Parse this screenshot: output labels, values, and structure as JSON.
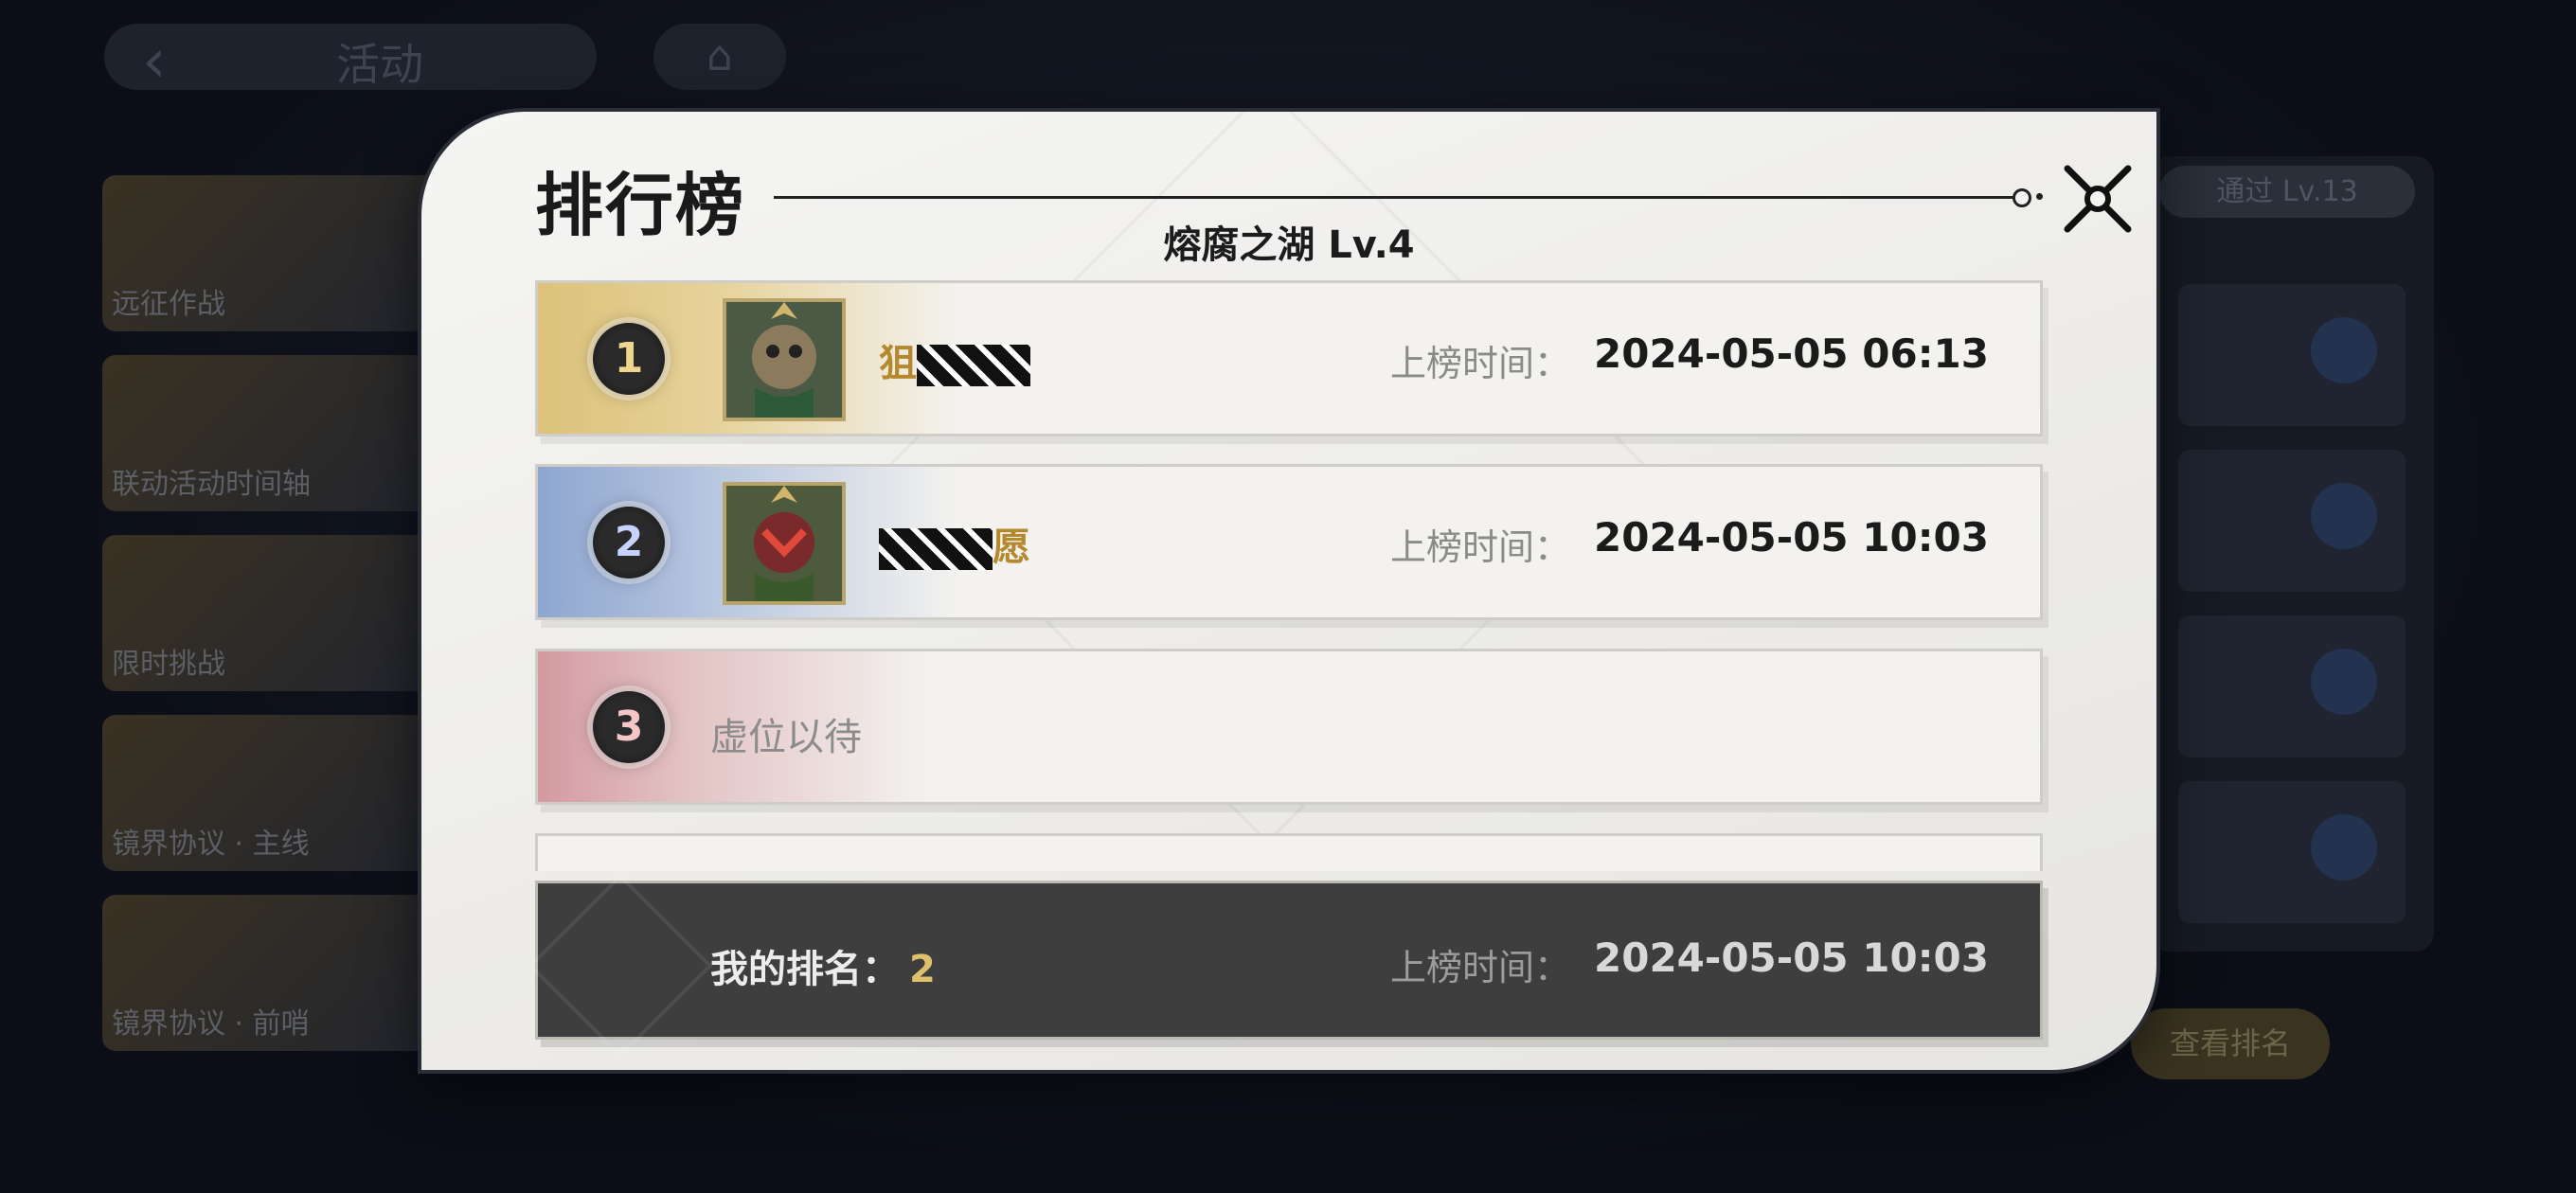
{
  "background": {
    "nav_title": "活动",
    "cards": [
      "远征作战",
      "联动活动时间轴",
      "限时挑战",
      "镜界协议 · 主线",
      "镜界协议 · 前哨"
    ],
    "level_badge": "通过 Lv.13",
    "view_button": "查看排名"
  },
  "modal": {
    "title": "排行榜",
    "stage": "熔腐之湖 Lv.4",
    "time_label": "上榜时间：",
    "rows": [
      {
        "rank": "1",
        "name_prefix": "狙",
        "name_suffix": "",
        "time": "2024-05-05 06:13"
      },
      {
        "rank": "2",
        "name_prefix": "",
        "name_suffix": "愿",
        "time": "2024-05-05 10:03"
      },
      {
        "rank": "3",
        "placeholder": "虚位以待"
      }
    ],
    "my_rank": {
      "label": "我的排名：",
      "value": "2",
      "time_label": "上榜时间：",
      "time": "2024-05-05 10:03"
    }
  },
  "colors": {
    "gold": "#b3882e",
    "rank1": "#dcc27a",
    "rank2": "#8ea6d0",
    "rank3": "#d39aa0",
    "my_rank_value": "#e1c06c"
  },
  "icons": [
    "back-icon",
    "home-icon",
    "close-icon",
    "rank-medal-icon"
  ]
}
